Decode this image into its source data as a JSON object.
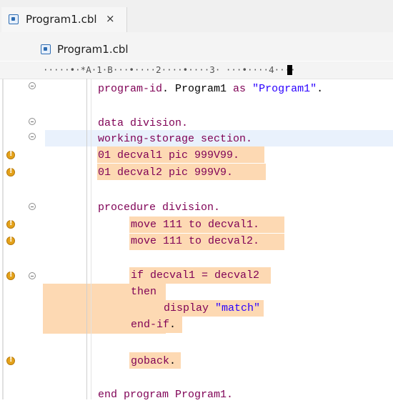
{
  "tab": {
    "title": "Program1.cbl",
    "close": "×"
  },
  "breadcrumb": {
    "file": "Program1.cbl"
  },
  "ruler": {
    "text": "·····•·*A·1·B···•····2····•····3· ···•····4····"
  },
  "code": {
    "l1_kw": "program-id",
    "l1_a": ". Program1 ",
    "l1_as": "as",
    "l1_sp": " ",
    "l1_str": "\"Program1\"",
    "l1_end": ".",
    "l2": "data division.",
    "l3": "working-storage section.",
    "l4_a": "01 decval1 ",
    "l4_pic": "pic",
    "l4_b": " 999V99.",
    "l5_a": "01 decval2 ",
    "l5_pic": "pic",
    "l5_b": " 999V9.",
    "l6": "procedure division.",
    "l7_move": "move",
    "l7_a": " 111 ",
    "l7_to": "to",
    "l7_b": " decval1.",
    "l8_move": "move",
    "l8_a": " 111 ",
    "l8_to": "to",
    "l8_b": " decval2.",
    "l9_if": "if",
    "l9_rest": " decval1 = decval2",
    "l10": "then",
    "l11_disp": "display",
    "l11_sp": " ",
    "l11_str": "\"match\"",
    "l12_a": "end-if",
    "l12_b": ".",
    "l13_a": "goback",
    "l13_b": ".",
    "l14_a": "end program",
    "l14_b": " Program1."
  },
  "colors": {
    "keyword": "#7f0055",
    "string": "#2a00ff",
    "warning_highlight": "#fdd9b3",
    "current_line": "#e9f1fc",
    "warning_icon": "#e4a21a"
  }
}
